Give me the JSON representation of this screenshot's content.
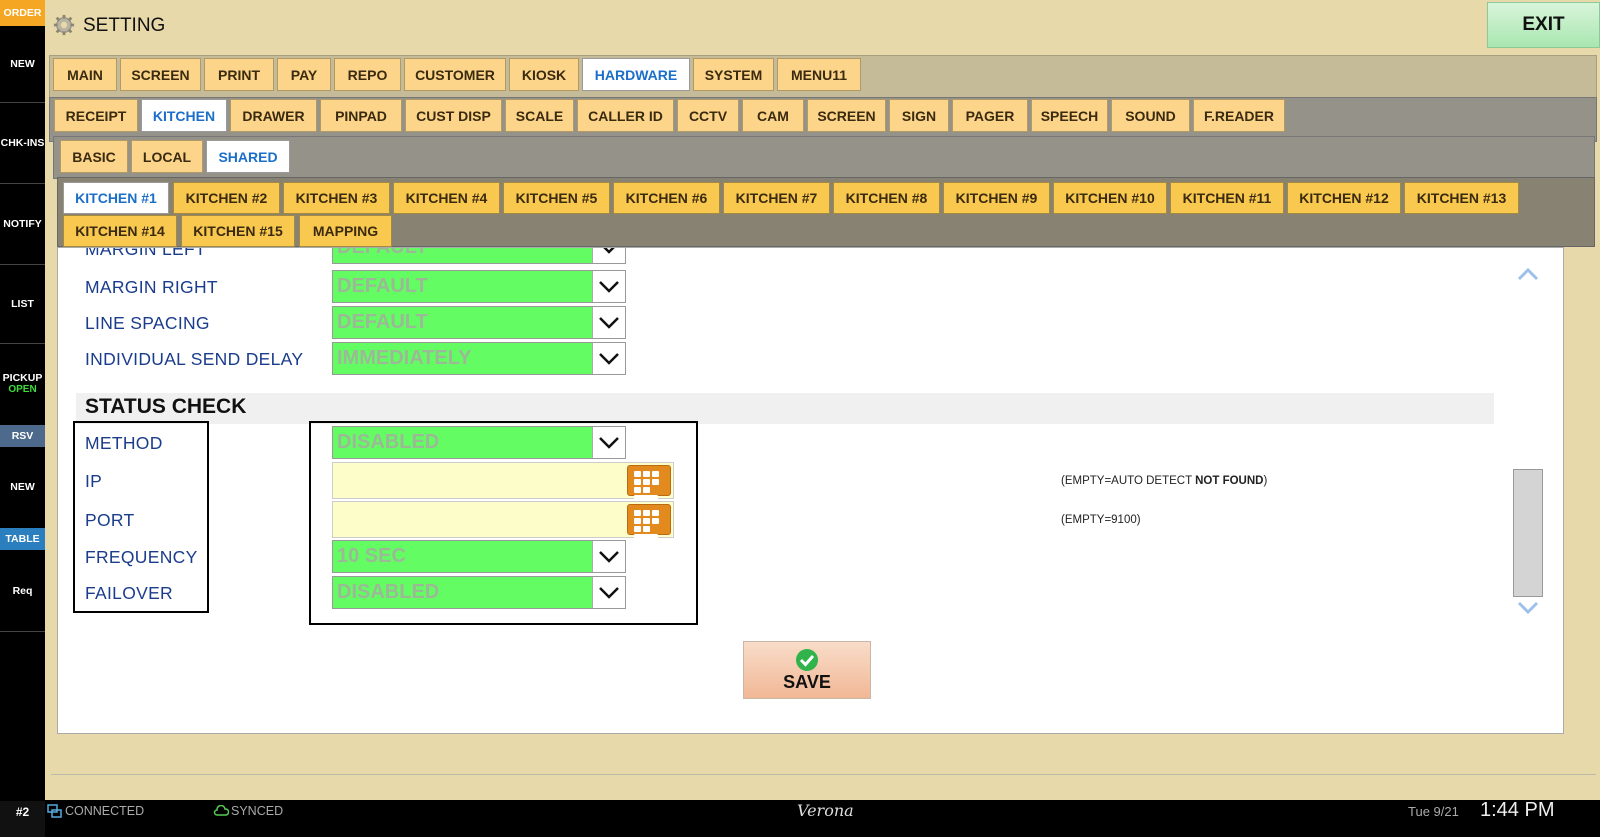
{
  "app": {
    "title": "SETTING",
    "exit_label": "EXIT"
  },
  "left_nav": [
    {
      "label": "ORDER",
      "sub": ""
    },
    {
      "label": "NEW",
      "sub": ""
    },
    {
      "label": "CHK-INS",
      "sub": ""
    },
    {
      "label": "NOTIFY",
      "sub": ""
    },
    {
      "label": "LIST",
      "sub": ""
    },
    {
      "label": "PICKUP",
      "sub": "OPEN"
    },
    {
      "label": "RSV",
      "sub": ""
    },
    {
      "label": "NEW",
      "sub": ""
    },
    {
      "label": "TABLE",
      "sub": ""
    },
    {
      "label": "Req",
      "sub": ""
    }
  ],
  "main_tabs": [
    "MAIN",
    "SCREEN",
    "PRINT",
    "PAY",
    "REPO",
    "CUSTOMER",
    "KIOSK",
    "HARDWARE",
    "SYSTEM",
    "MENU11"
  ],
  "hardware_tabs": [
    "RECEIPT",
    "KITCHEN",
    "DRAWER",
    "PINPAD",
    "CUST DISP",
    "SCALE",
    "CALLER ID",
    "CCTV",
    "CAM",
    "SCREEN",
    "SIGN",
    "PAGER",
    "SPEECH",
    "SOUND",
    "F.READER"
  ],
  "kitchen_mode_tabs": [
    "BASIC",
    "LOCAL",
    "SHARED"
  ],
  "kitchen_tabs": [
    "KITCHEN #1",
    "KITCHEN #2",
    "KITCHEN #3",
    "KITCHEN #4",
    "KITCHEN #5",
    "KITCHEN #6",
    "KITCHEN #7",
    "KITCHEN #8",
    "KITCHEN #9",
    "KITCHEN #10",
    "KITCHEN #11",
    "KITCHEN #12",
    "KITCHEN #13",
    "KITCHEN #14",
    "KITCHEN #15",
    "MAPPING"
  ],
  "active": {
    "main": "HARDWARE",
    "hardware": "KITCHEN",
    "mode": "SHARED",
    "kitchen": "KITCHEN #1"
  },
  "form": {
    "margin_left": {
      "label": "MARGIN LEFT",
      "value": "DEFAULT"
    },
    "margin_right": {
      "label": "MARGIN RIGHT",
      "value": "DEFAULT"
    },
    "line_spacing": {
      "label": "LINE SPACING",
      "value": "DEFAULT"
    },
    "send_delay": {
      "label": "INDIVIDUAL SEND DELAY",
      "value": "IMMEDIATELY"
    },
    "section_title": "STATUS CHECK",
    "method": {
      "label": "METHOD",
      "value": "DISABLED"
    },
    "ip": {
      "label": "IP",
      "value": "",
      "hint": "(EMPTY=AUTO DETECT ",
      "hint_bold": "NOT FOUND",
      "hint_end": ")"
    },
    "port": {
      "label": "PORT",
      "value": "",
      "hint": "(EMPTY=9100)"
    },
    "frequency": {
      "label": "FREQUENCY",
      "value": "10 SEC"
    },
    "failover": {
      "label": "FAILOVER",
      "value": "DISABLED"
    },
    "save_label": "SAVE"
  },
  "status_bar": {
    "station": "#2",
    "connected": "CONNECTED",
    "synced": "SYNCED",
    "location": "Verona",
    "date": "Tue 9/21",
    "time": "1:44 PM"
  },
  "colors": {
    "dropdown_bg": "#63fd63",
    "accent_blue": "#1b6fc9",
    "tab_bg": "#fcd58a"
  }
}
